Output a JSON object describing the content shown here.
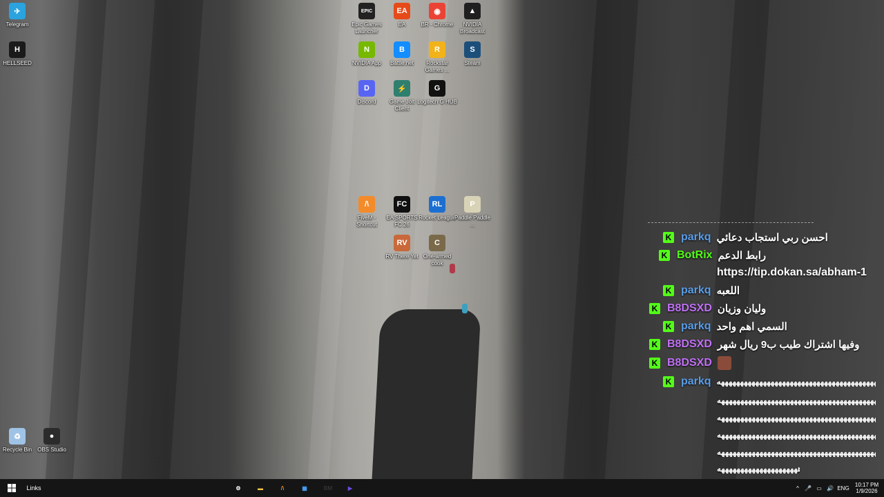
{
  "desktop_icons": [
    {
      "label": "Telegram",
      "glyph": "✈",
      "color": "#2aa3df"
    },
    {
      "label": "HELLSEED",
      "glyph": "H",
      "color": "#1a1a1a"
    },
    {
      "label": "Recycle Bin",
      "glyph": "♻",
      "color": "#9fc3e6"
    },
    {
      "label": "OBS Studio",
      "glyph": "●",
      "color": "#2b2b2b"
    },
    {
      "label": "Epic Games Launcher",
      "glyph": "EPIC",
      "color": "#222222"
    },
    {
      "label": "EA",
      "glyph": "EA",
      "color": "#e64a19"
    },
    {
      "label": "BR - Chrome",
      "glyph": "◉",
      "color": "#ea4335"
    },
    {
      "label": "NVIDIA Broadcast",
      "glyph": "▲",
      "color": "#1f1f1f"
    },
    {
      "label": "NVIDIA App",
      "glyph": "N",
      "color": "#76b900"
    },
    {
      "label": "Battle.net",
      "glyph": "B",
      "color": "#148eff"
    },
    {
      "label": "Rockstar Games ...",
      "glyph": "R",
      "color": "#f2b21a"
    },
    {
      "label": "Steam",
      "glyph": "S",
      "color": "#1b4f7a"
    },
    {
      "label": "Discord",
      "glyph": "D",
      "color": "#5865f2"
    },
    {
      "label": "Game Jolt Client",
      "glyph": "⚡",
      "color": "#2f7f6f"
    },
    {
      "label": "Logitech G HUB",
      "glyph": "G",
      "color": "#111111"
    },
    {
      "label": "FiveM - Shortcut",
      "glyph": "/\\",
      "color": "#f48b2a"
    },
    {
      "label": "EA SPORTS FC 26",
      "glyph": "FC",
      "color": "#101010"
    },
    {
      "label": "Rocket League",
      "glyph": "RL",
      "color": "#1c6fd0"
    },
    {
      "label": "Paddle Paddle ...",
      "glyph": "P",
      "color": "#d8d2b6"
    },
    {
      "label": "RV There Yet",
      "glyph": "RV",
      "color": "#c9683a"
    },
    {
      "label": "One-armed cook",
      "glyph": "C",
      "color": "#7a6a4a"
    }
  ],
  "chat": {
    "messages": [
      {
        "user": "parkq",
        "user_color": "#5a9de8",
        "text": "احسن ربي استجاب دعائي"
      },
      {
        "user": "BotRix",
        "user_color": "#53fc18",
        "text": "رابط الدعم"
      },
      {
        "user": "",
        "user_color": "#ffffff",
        "text": "https://tip.dokan.sa/abham-1"
      },
      {
        "user": "parkq",
        "user_color": "#5a9de8",
        "text": "اللعبه"
      },
      {
        "user": "B8DSXD",
        "user_color": "#c070f5",
        "text": "وليان وزيان"
      },
      {
        "user": "parkq",
        "user_color": "#5a9de8",
        "text": "السمي اهم واحد"
      },
      {
        "user": "B8DSXD",
        "user_color": "#c070f5",
        "text": "وفيها اشتراك طيب ب9 ريال شهر"
      },
      {
        "user": "B8DSXD",
        "user_color": "#c070f5",
        "text": ""
      },
      {
        "user": "parkq",
        "user_color": "#5a9de8",
        "text": "ههههههههههههههههههههههههههههههههههههههههههههههه"
      }
    ],
    "spam_lines": [
      "ههههههههههههههههههههههههههههههههههههههههههههههه",
      "ههههههههههههههههههههههههههههههههههههههههههههههه",
      "ههههههههههههههههههههههههههههههههههههههههههههههه",
      "ههههههههههههههههههههههههههههههههههههههههههههههه",
      "هههههههههههههههههههههه"
    ],
    "badge": "K"
  },
  "taskbar": {
    "links_label": "Links",
    "language": "ENG",
    "time": "10:17 PM",
    "date": "1/9/2026",
    "apps": [
      {
        "name": "settings-app",
        "glyph": "⚙",
        "color": "#ffffff"
      },
      {
        "name": "file-explorer",
        "glyph": "▬",
        "color": "#f5c542"
      },
      {
        "name": "fivem",
        "glyph": "/\\",
        "color": "#f48b2a"
      },
      {
        "name": "microsoft-store",
        "glyph": "▦",
        "color": "#4aa3ff"
      },
      {
        "name": "bm-app",
        "glyph": "BM",
        "color": "#333333"
      },
      {
        "name": "media-app",
        "glyph": "▶",
        "color": "#6b4de6"
      }
    ]
  }
}
